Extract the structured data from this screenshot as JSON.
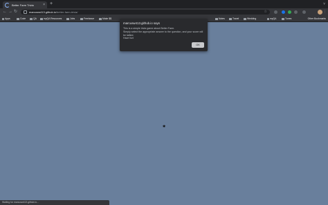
{
  "browser": {
    "tab": {
      "title": "Better Farm Trivia",
      "close": "×"
    },
    "new_tab": "+",
    "window_controls": "˅",
    "nav": {
      "back": "←",
      "forward": "→",
      "reload": "↻"
    },
    "address": {
      "host": "marcusw413.github.io",
      "path": "/better-farm-trivia/"
    },
    "bookmarks": [
      "Apps",
      "Code",
      "QA",
      "myQA Resources",
      "Jobs",
      "Freelance",
      "Make $$",
      "Notes",
      "Travel",
      "Wedding",
      "myQA",
      "Tunes"
    ],
    "other_bookmarks": "Other Bookmarks",
    "status": "Waiting for marcusw413.github.io..."
  },
  "dialog": {
    "title": "marcusw413.github.io says",
    "message": "This is a simple trivia game about Better Farm.\nSimply select the appropriate answer to the question, and your score will be tallied.\nHave fun!",
    "ok_label": "OK"
  },
  "colors": {
    "page_background": "#697f9c",
    "chrome_dark": "#35363a",
    "dialog_bg": "#292a2d"
  },
  "icons": {
    "lock": "lock-icon",
    "star": "star-icon",
    "menu": "kebab-menu-icon",
    "spinner": "loading-spinner-icon",
    "cursor": "mouse-pointer-icon"
  }
}
